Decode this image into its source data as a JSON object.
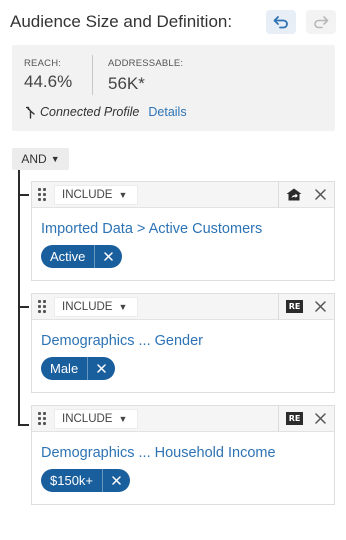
{
  "header": {
    "title": "Audience Size and Definition:",
    "undo_icon": "undo-icon",
    "redo_icon": "redo-icon"
  },
  "stats": {
    "reach_label": "REACH:",
    "reach_value": "44.6%",
    "addressable_label": "ADDRESSABLE:",
    "addressable_value": "56K*"
  },
  "profile": {
    "icon": "branch-icon",
    "text": "Connected Profile",
    "details_link": "Details"
  },
  "logic": {
    "operator": "AND"
  },
  "rules": [
    {
      "mode": "INCLUDE",
      "icon": "home-share-icon",
      "path": "Imported Data > Active Customers",
      "chip": "Active"
    },
    {
      "mode": "INCLUDE",
      "icon": "re-badge",
      "badge_text": "RE",
      "path": "Demographics ... Gender",
      "chip": "Male"
    },
    {
      "mode": "INCLUDE",
      "icon": "re-badge",
      "badge_text": "RE",
      "path": "Demographics ... Household Income",
      "chip": "$150k+"
    }
  ],
  "colors": {
    "link": "#2d73b5",
    "chip": "#1a5f9d",
    "panel": "#f2f2f2"
  }
}
